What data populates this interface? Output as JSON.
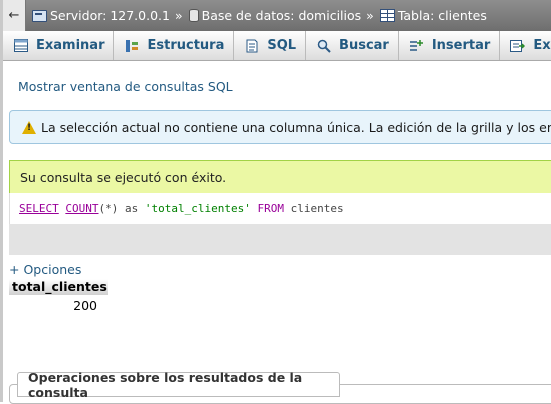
{
  "breadcrumb": {
    "back": "←",
    "server": "Servidor: 127.0.0.1",
    "separator": "»",
    "database": "Base de datos: domicilios",
    "table": "Tabla: clientes"
  },
  "tabs": [
    {
      "label": "Examinar",
      "icon": "browse-icon"
    },
    {
      "label": "Estructura",
      "icon": "structure-icon"
    },
    {
      "label": "SQL",
      "icon": "sql-icon"
    },
    {
      "label": "Buscar",
      "icon": "search-icon"
    },
    {
      "label": "Insertar",
      "icon": "insert-icon"
    },
    {
      "label": "Exportar",
      "icon": "export-icon"
    }
  ],
  "show_sql_link": "Mostrar ventana de consultas SQL",
  "notice": "La selección actual no contiene una columna única. La edición de la grilla y los enlaces de copiado, eliminación y edición no están disponibles.",
  "success_message": "Su consulta se ejecutó con éxito.",
  "sql": {
    "select": "SELECT",
    "count": "COUNT",
    "arg": "(*)",
    "as": "as",
    "alias": "'total_clientes'",
    "from": "FROM",
    "table": "clientes"
  },
  "options_link": "+ Opciones",
  "result": {
    "column": "total_clientes",
    "value": "200"
  },
  "operations_title": "Operaciones sobre los resultados de la consulta",
  "colors": {
    "link": "#235a81",
    "success_bg": "#ebf8a4",
    "notice_bg": "#e8f4fb",
    "breadcrumb_bg": "#7e7e7e"
  }
}
